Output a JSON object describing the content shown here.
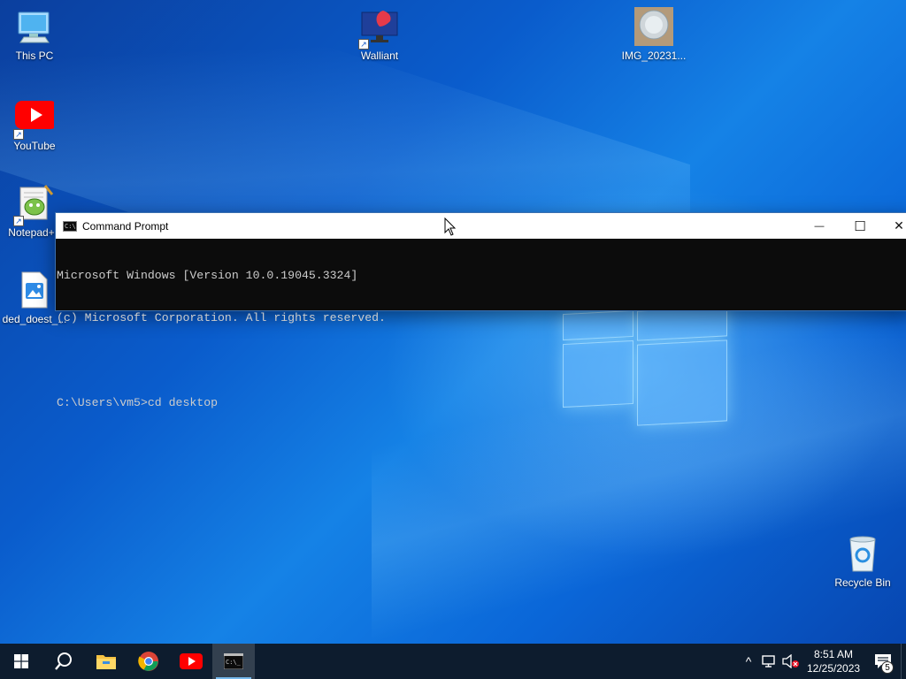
{
  "desktop": {
    "icons": {
      "this_pc": "This PC",
      "youtube": "YouTube",
      "notepad": "Notepad++",
      "ded_doest": "ded_doest_...",
      "walliant": "Walliant",
      "img": "IMG_20231...",
      "recycle_bin": "Recycle Bin"
    }
  },
  "cmd_window": {
    "title": "Command Prompt",
    "lines": [
      "Microsoft Windows [Version 10.0.19045.3324]",
      "(c) Microsoft Corporation. All rights reserved.",
      "",
      "C:\\Users\\vm5>cd desktop"
    ],
    "minimize_glyph": "—",
    "maximize_glyph": "☐",
    "close_glyph": "✕"
  },
  "taskbar": {
    "pinned": [
      "start-icon",
      "search-icon",
      "file-explorer-icon",
      "chrome-icon",
      "youtube-icon",
      "command-prompt-icon"
    ],
    "clock": {
      "time": "8:51 AM",
      "date": "12/25/2023"
    },
    "notification_count": "5",
    "show_hidden_glyph": "^"
  },
  "colors": {
    "taskbar_bg": "#0d1c2e",
    "active_underline": "#76b9ed",
    "console_bg": "#0c0c0c",
    "console_fg": "#cccccc"
  }
}
